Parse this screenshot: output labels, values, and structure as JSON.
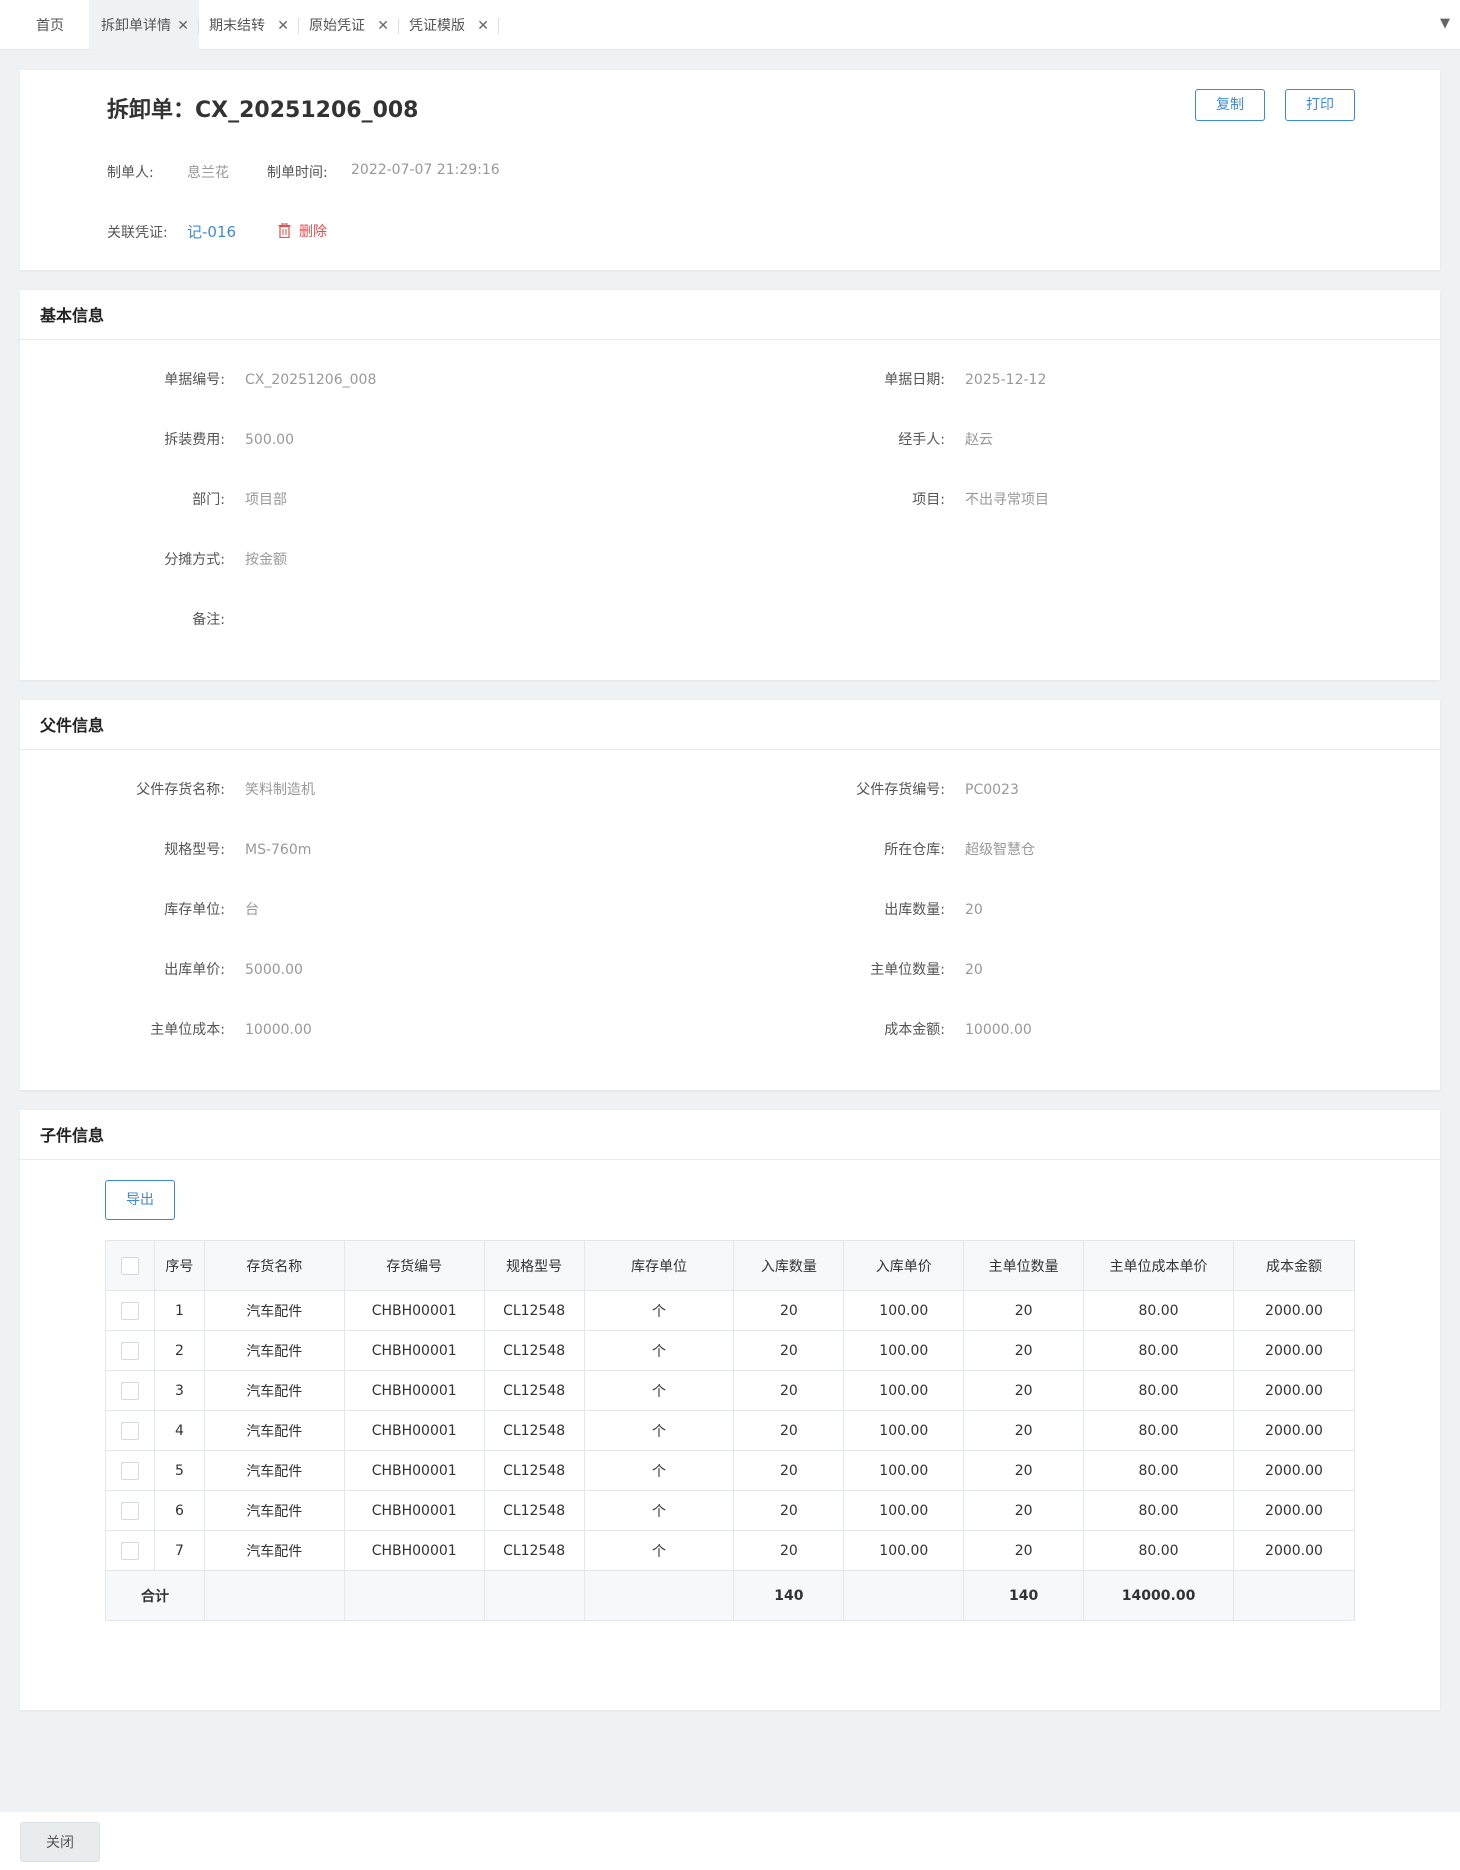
{
  "tabs": [
    {
      "label": "首页",
      "closable": false,
      "active": false
    },
    {
      "label": "拆卸单详情",
      "closable": true,
      "active": true
    },
    {
      "label": "期末结转",
      "closable": true,
      "active": false
    },
    {
      "label": "原始凭证",
      "closable": true,
      "active": false
    },
    {
      "label": "凭证模版",
      "closable": true,
      "active": false
    }
  ],
  "close_glyph": "✕",
  "dropdown_glyph": "▼",
  "header": {
    "title": "拆卸单：CX_20251206_008",
    "copy_label": "复制",
    "print_label": "打印",
    "creator_label": "制单人:",
    "creator": "息兰花",
    "created_time_label": "制单时间:",
    "created_time": "2022-07-07 21:29:16",
    "voucher_label": "关联凭证:",
    "voucher": "记-016",
    "delete_label": "删除"
  },
  "basic": {
    "title": "基本信息",
    "doc_no_label": "单据编号:",
    "doc_no": "CX_20251206_008",
    "doc_date_label": "单据日期:",
    "doc_date": "2025-12-12",
    "fee_label": "拆装费用:",
    "fee": "500.00",
    "handler_label": "经手人:",
    "handler": "赵云",
    "dept_label": "部门:",
    "dept": "项目部",
    "project_label": "项目:",
    "project": "不出寻常项目",
    "alloc_label": "分摊方式:",
    "alloc": "按金额",
    "remark_label": "备注:",
    "remark": ""
  },
  "parent": {
    "title": "父件信息",
    "name_label": "父件存货名称:",
    "name": "笑料制造机",
    "code_label": "父件存货编号:",
    "code": "PC0023",
    "spec_label": "规格型号:",
    "spec": "MS-760m",
    "warehouse_label": "所在仓库:",
    "warehouse": "超级智慧仓",
    "unit_label": "库存单位:",
    "unit": "台",
    "out_qty_label": "出库数量:",
    "out_qty": "20",
    "out_price_label": "出库单价:",
    "out_price": "5000.00",
    "main_qty_label": "主单位数量:",
    "main_qty": "20",
    "main_cost_label": "主单位成本:",
    "main_cost": "10000.00",
    "cost_amount_label": "成本金额:",
    "cost_amount": "10000.00"
  },
  "children": {
    "title": "子件信息",
    "export_label": "导出",
    "columns": [
      "序号",
      "存货名称",
      "存货编号",
      "规格型号",
      "库存单位",
      "入库数量",
      "入库单价",
      "主单位数量",
      "主单位成本单价",
      "成本金额"
    ],
    "rows": [
      [
        "1",
        "汽车配件",
        "CHBH00001",
        "CL12548",
        "个",
        "20",
        "100.00",
        "20",
        "80.00",
        "2000.00"
      ],
      [
        "2",
        "汽车配件",
        "CHBH00001",
        "CL12548",
        "个",
        "20",
        "100.00",
        "20",
        "80.00",
        "2000.00"
      ],
      [
        "3",
        "汽车配件",
        "CHBH00001",
        "CL12548",
        "个",
        "20",
        "100.00",
        "20",
        "80.00",
        "2000.00"
      ],
      [
        "4",
        "汽车配件",
        "CHBH00001",
        "CL12548",
        "个",
        "20",
        "100.00",
        "20",
        "80.00",
        "2000.00"
      ],
      [
        "5",
        "汽车配件",
        "CHBH00001",
        "CL12548",
        "个",
        "20",
        "100.00",
        "20",
        "80.00",
        "2000.00"
      ],
      [
        "6",
        "汽车配件",
        "CHBH00001",
        "CL12548",
        "个",
        "20",
        "100.00",
        "20",
        "80.00",
        "2000.00"
      ],
      [
        "7",
        "汽车配件",
        "CHBH00001",
        "CL12548",
        "个",
        "20",
        "100.00",
        "20",
        "80.00",
        "2000.00"
      ]
    ],
    "total": {
      "label": "合计",
      "in_qty": "140",
      "main_qty": "140",
      "main_cost": "14000.00"
    }
  },
  "footer": {
    "close_label": "关闭"
  },
  "colors": {
    "accent": "#3d8bd6",
    "danger": "#e84c4c",
    "page_bg": "#eff2f4"
  }
}
